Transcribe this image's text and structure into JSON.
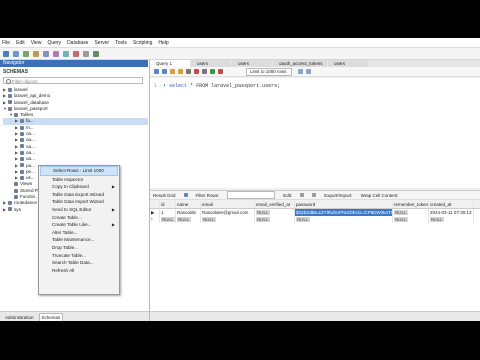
{
  "menubar": [
    "File",
    "Edit",
    "View",
    "Query",
    "Database",
    "Server",
    "Tools",
    "Scripting",
    "Help"
  ],
  "navigator": {
    "header": "Navigator",
    "schemas_label": "SCHEMAS",
    "filter_placeholder": "Filter objects"
  },
  "tree": [
    {
      "label": "laravel",
      "indent": 1,
      "arrow": "▶"
    },
    {
      "label": "laravel_api_demo",
      "indent": 1,
      "arrow": "▶"
    },
    {
      "label": "laravel_database",
      "indent": 1,
      "arrow": "▶"
    },
    {
      "label": "laravel_passport",
      "indent": 1,
      "arrow": "▼"
    },
    {
      "label": "Tables",
      "indent": 2,
      "arrow": "▼"
    },
    {
      "label": "fa...",
      "indent": 3,
      "arrow": "▶",
      "selected": true
    },
    {
      "label": "m...",
      "indent": 3,
      "arrow": "▶"
    },
    {
      "label": "oa...",
      "indent": 3,
      "arrow": "▶"
    },
    {
      "label": "oa...",
      "indent": 3,
      "arrow": "▶"
    },
    {
      "label": "oa...",
      "indent": 3,
      "arrow": "▶"
    },
    {
      "label": "oa...",
      "indent": 3,
      "arrow": "▶"
    },
    {
      "label": "oa...",
      "indent": 3,
      "arrow": "▶"
    },
    {
      "label": "pa...",
      "indent": 3,
      "arrow": "▶"
    },
    {
      "label": "pe...",
      "indent": 3,
      "arrow": "▶"
    },
    {
      "label": "us...",
      "indent": 3,
      "arrow": "▶"
    },
    {
      "label": "Views",
      "indent": 2,
      "arrow": ""
    },
    {
      "label": "Stored P...",
      "indent": 2,
      "arrow": ""
    },
    {
      "label": "Functio...",
      "indent": 2,
      "arrow": ""
    },
    {
      "label": "routedance",
      "indent": 1,
      "arrow": "▶"
    },
    {
      "label": "sys",
      "indent": 1,
      "arrow": "▶"
    }
  ],
  "bottom_tabs": [
    "Administration",
    "Schemas"
  ],
  "query_tabs": [
    "Query 1",
    "users",
    "users",
    "oauth_access_tokens",
    "users"
  ],
  "limit_select": "Limit to 1000 rows",
  "editor": {
    "line_no": "1",
    "keyword": "select",
    "rest": "* FROM laravel_passport.users;"
  },
  "result_bar": {
    "result_grid": "Result Grid",
    "filter_label": "Filter Rows:",
    "edit": "Edit:",
    "export": "Export/Import:",
    "wrap": "Wrap Cell Content:"
  },
  "grid": {
    "columns": [
      "id",
      "name",
      "email",
      "email_verified_at",
      "password",
      "remember_token",
      "created_at"
    ],
    "row1": {
      "id": "1",
      "name": "Rasoolde",
      "email": "Rasooldev@gmail.com",
      "email_verified_at": "NULL",
      "password": "$2y$10$BucZYlRuhUPNnrDEr4c./CP8DW3k4TS...",
      "remember_token": "NULL",
      "created_at": "2024-03-11 07:30:13"
    },
    "row2": {
      "id": "NULL",
      "name": "NULL",
      "email": "NULL",
      "email_verified_at": "NULL",
      "password": "NULL",
      "remember_token": "NULL",
      "created_at": "NULL"
    }
  },
  "context_menu": [
    {
      "label": "Select Rows - Limit 1000",
      "hover": true
    },
    {
      "label": "Table Inspector"
    },
    {
      "label": "Copy to Clipboard",
      "submenu": true
    },
    {
      "label": "Table Data Export Wizard"
    },
    {
      "label": "Table Data Import Wizard"
    },
    {
      "label": "Send to SQL Editor",
      "submenu": true
    },
    {
      "label": "Create Table..."
    },
    {
      "label": "Create Table Like...",
      "submenu": true
    },
    {
      "label": "Alter Table..."
    },
    {
      "label": "Table Maintenance..."
    },
    {
      "label": "Drop Table..."
    },
    {
      "label": "Truncate Table..."
    },
    {
      "label": "Search Table Data..."
    },
    {
      "label": "Refresh All"
    }
  ],
  "colors": {
    "nav_header": "#3c6fb5",
    "selection": "#3a77c9",
    "menu_hover": "#cde3f8"
  }
}
